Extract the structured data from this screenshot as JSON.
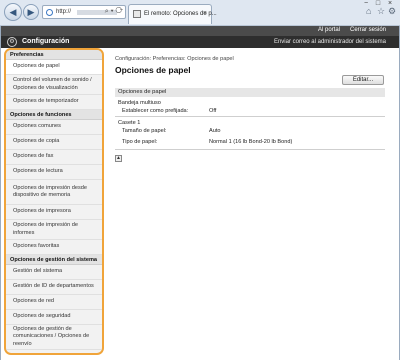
{
  "browser": {
    "url_prefix": "http://",
    "tab_title": "El remoto: Opciones de p...",
    "window_controls": [
      "−",
      "□",
      "×"
    ]
  },
  "header": {
    "portal_link": "Al portal",
    "logout_link": "Cerrar sesión",
    "app_title": "Configuración",
    "admin_link": "Enviar correo al administrador del sistema"
  },
  "sidebar": {
    "items": [
      {
        "type": "section",
        "label": "Preferencias"
      },
      {
        "type": "item",
        "label": "Opciones de papel",
        "active": true
      },
      {
        "type": "item",
        "label": "Control del volumen de sonido / Opciones de visualización"
      },
      {
        "type": "item",
        "label": "Opciones de temporizador"
      },
      {
        "type": "section",
        "label": "Opciones de funciones"
      },
      {
        "type": "item",
        "label": "Opciones comunes"
      },
      {
        "type": "item",
        "label": "Opciones de copia"
      },
      {
        "type": "item",
        "label": "Opciones de fax"
      },
      {
        "type": "item",
        "label": "Opciones de lectura"
      },
      {
        "type": "item",
        "label": "Opciones de impresión desde dispositivo de memoria"
      },
      {
        "type": "item",
        "label": "Opciones de impresora"
      },
      {
        "type": "item",
        "label": "Opciones de impresión de informes"
      },
      {
        "type": "item",
        "label": "Opciones favoritas"
      },
      {
        "type": "section",
        "label": "Opciones de gestión del sistema"
      },
      {
        "type": "item",
        "label": "Gestión del sistema"
      },
      {
        "type": "item",
        "label": "Gestión de ID de departamentos"
      },
      {
        "type": "item",
        "label": "Opciones de red"
      },
      {
        "type": "item",
        "label": "Opciones de seguridad"
      },
      {
        "type": "item",
        "label": "Opciones de gestión de comunicaciones / Opciones de reenvío"
      }
    ]
  },
  "main": {
    "breadcrumb": "Configuración: Preferencias: Opciones de papel",
    "page_title": "Opciones de papel",
    "edit_button": "Editar...",
    "section_title": "Opciones de papel",
    "multipurpose_tray": "Bandeja multiuso",
    "set_as_preferred_label": "Establecer como prefijada:",
    "set_as_preferred_value": "Off",
    "cassette": "Casete 1",
    "paper_size_label": "Tamaño de papel:",
    "paper_size_value": "Auto",
    "paper_type_label": "Tipo de papel:",
    "paper_type_value": "Normal 1 (16 lb Bond-20 lb Bond)"
  }
}
